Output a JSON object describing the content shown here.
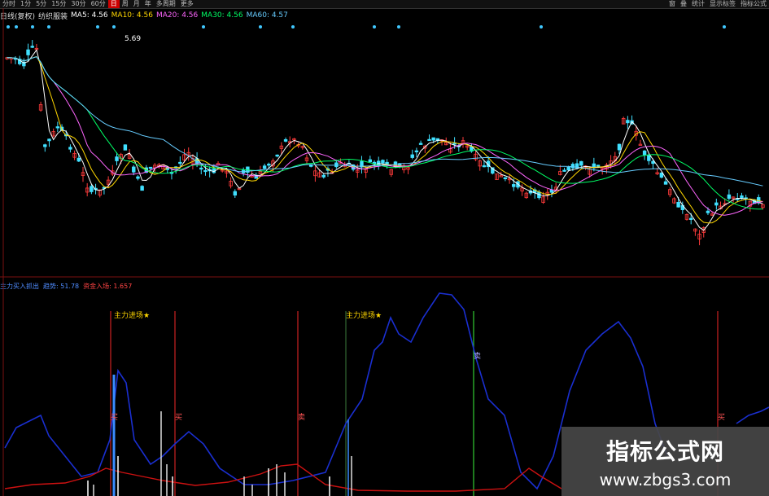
{
  "toolbar": {
    "items": [
      "分时",
      "1分",
      "5分",
      "15分",
      "30分",
      "60分",
      "日",
      "周",
      "月",
      "年",
      "多周期",
      "更多"
    ],
    "active_index": 6,
    "right_items": [
      "窗",
      "叠",
      "统计",
      "显示标签",
      "指标公式"
    ]
  },
  "upper_legend": {
    "title": "日线(复权)",
    "sector": "纺织服装",
    "ma5": "MA5: 4.56",
    "ma10": "MA10: 4.56",
    "ma20": "MA20: 4.56",
    "ma30": "MA30: 4.56",
    "ma60": "MA60: 4.57"
  },
  "price_label": "5.69",
  "lower_legend": {
    "indicator": "主力买入抓出",
    "label1": "趋势: 51.78",
    "label2": "资金入场: 1.657"
  },
  "annotations": [
    {
      "text": "主力进场★",
      "color": "#ffd700"
    },
    {
      "text": "主力进场★",
      "color": "#ffd700"
    },
    {
      "text": "买",
      "color": "#ff5555"
    },
    {
      "text": "买",
      "color": "#ff5555"
    },
    {
      "text": "卖",
      "color": "#ff5555"
    },
    {
      "text": "卖",
      "color": "#aaaaff"
    },
    {
      "text": "买",
      "color": "#ff5555"
    }
  ],
  "watermark": {
    "title": "指标公式网",
    "url": "www.zbgs3.com"
  },
  "colors": {
    "up": "#ff3b3b",
    "down": "#40e0ff",
    "ma5": "#ffffff",
    "ma10": "#ffd700",
    "ma20": "#ff66ff",
    "ma30": "#00ff66",
    "ma60": "#66ccff",
    "curve_blue": "#1a2fd0",
    "curve_red": "#cc1111",
    "vline_red": "#cc2222",
    "vline_green": "#33cc33"
  }
}
